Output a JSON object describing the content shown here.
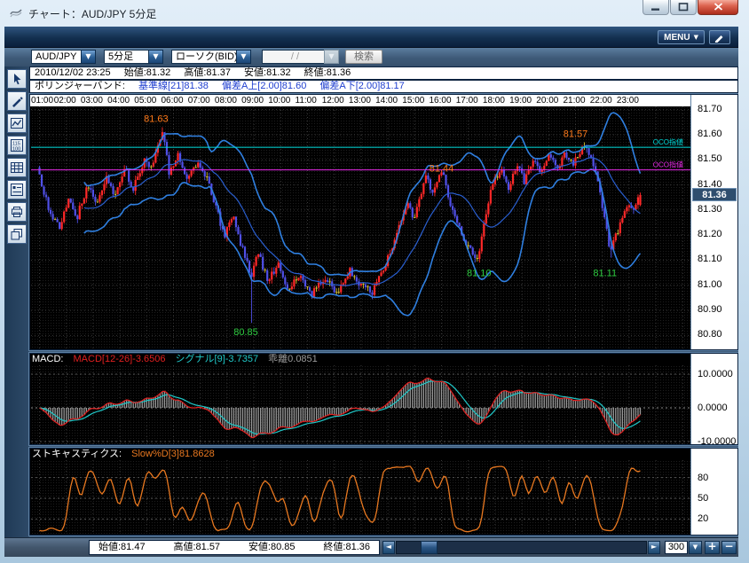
{
  "titlebar": {
    "title": "チャート：AUD/JPY 5分足"
  },
  "menubar": {
    "menu_label": "MENU"
  },
  "toolbar": {
    "pair": "AUD/JPY",
    "timeframe": "5分足",
    "style": "ローソク(BID)",
    "date_value": "/    /",
    "search_label": "検索"
  },
  "left_toolbar": {
    "icons": [
      "pointer",
      "pencil",
      "indicator",
      "quote-list",
      "grid",
      "settings",
      "printer",
      "new-window"
    ]
  },
  "quote_bar": {
    "datetime": "2010/12/02 23:25",
    "open": "始値:81.32",
    "high": "高値:81.37",
    "low": "安値:81.32",
    "close": "終値:81.36"
  },
  "bollinger_bar": {
    "label": "ボリンジャーバンド:",
    "center": "基準線[21]81.38",
    "upper": "偏差A上[2.00]81.60",
    "lower": "偏差A下[2.00]81.17"
  },
  "macd_bar": {
    "label": "MACD:",
    "macd": "MACD[12-26]-3.6506",
    "signal": "シグナル[9]-3.7357",
    "divergence": "乖離0.0851"
  },
  "stoch_bar": {
    "label": "ストキャスティクス:",
    "value": "Slow%D[3]81.8628"
  },
  "bottom_bar": {
    "open": "始値:81.47",
    "high": "高値:81.57",
    "low": "安値:80.85",
    "close": "終値:81.36",
    "bar_count": "300",
    "scroll_left": "◄",
    "scroll_right": "►",
    "count_caret": "▼",
    "zoom_in": "+",
    "zoom_out": "−"
  },
  "price_axis": {
    "ticks": [
      "81.70",
      "81.60",
      "81.50",
      "81.40",
      "81.30",
      "81.20",
      "81.10",
      "81.00",
      "80.90",
      "80.80"
    ],
    "current": "81.36"
  },
  "macd_axis": [
    "10.0000",
    "0.0000",
    "-10.0000"
  ],
  "stoch_axis": [
    "80",
    "50",
    "20"
  ],
  "time_axis": [
    "01:00",
    "02:00",
    "03:00",
    "04:00",
    "05:00",
    "06:00",
    "07:00",
    "08:00",
    "09:00",
    "10:00",
    "11:00",
    "12:00",
    "13:00",
    "14:00",
    "15:00",
    "16:00",
    "17:00",
    "18:00",
    "19:00",
    "20:00",
    "21:00",
    "22:00",
    "23:00"
  ],
  "chart_data": {
    "type": "candlestick+indicators",
    "pair": "AUD/JPY",
    "bar_interval_minutes": 5,
    "date": "2010/12/02",
    "visible_hours": [
      1.0,
      23.42
    ],
    "session_ohlc": {
      "open": 81.47,
      "high": 81.57,
      "low": 80.85,
      "close": 81.36
    },
    "main": {
      "ylim": [
        80.75,
        81.71
      ],
      "yticks": [
        80.8,
        80.9,
        81.0,
        81.1,
        81.2,
        81.3,
        81.4,
        81.5,
        81.6,
        81.7
      ],
      "last_price": 81.36,
      "bollinger": {
        "period": 21,
        "deviation": 2.0,
        "center": 81.38,
        "upper": 81.6,
        "lower": 81.17
      },
      "price_waypoints": [
        [
          1.0,
          81.44
        ],
        [
          1.35,
          81.3
        ],
        [
          1.75,
          81.23
        ],
        [
          2.1,
          81.35
        ],
        [
          2.4,
          81.27
        ],
        [
          2.8,
          81.4
        ],
        [
          3.1,
          81.32
        ],
        [
          3.5,
          81.44
        ],
        [
          3.8,
          81.36
        ],
        [
          4.2,
          81.46
        ],
        [
          4.5,
          81.38
        ],
        [
          4.9,
          81.5
        ],
        [
          5.15,
          81.46
        ],
        [
          5.6,
          81.61
        ],
        [
          5.85,
          81.44
        ],
        [
          6.2,
          81.52
        ],
        [
          6.5,
          81.41
        ],
        [
          6.9,
          81.5
        ],
        [
          7.2,
          81.44
        ],
        [
          7.6,
          81.3
        ],
        [
          7.9,
          81.2
        ],
        [
          8.2,
          81.28
        ],
        [
          8.55,
          81.15
        ],
        [
          8.9,
          81.04
        ],
        [
          9.15,
          81.14
        ],
        [
          9.5,
          81.02
        ],
        [
          9.9,
          81.08
        ],
        [
          10.3,
          80.98
        ],
        [
          10.7,
          81.05
        ],
        [
          11.1,
          80.96
        ],
        [
          11.6,
          81.03
        ],
        [
          12.1,
          80.97
        ],
        [
          12.6,
          81.06
        ],
        [
          13.0,
          81.0
        ],
        [
          13.4,
          80.97
        ],
        [
          13.9,
          81.08
        ],
        [
          14.3,
          81.2
        ],
        [
          14.7,
          81.33
        ],
        [
          15.0,
          81.26
        ],
        [
          15.4,
          81.44
        ],
        [
          15.7,
          81.36
        ],
        [
          16.0,
          81.46
        ],
        [
          16.4,
          81.3
        ],
        [
          16.9,
          81.16
        ],
        [
          17.35,
          81.11
        ],
        [
          17.6,
          81.26
        ],
        [
          17.9,
          81.4
        ],
        [
          18.2,
          81.47
        ],
        [
          18.5,
          81.38
        ],
        [
          18.8,
          81.48
        ],
        [
          19.1,
          81.41
        ],
        [
          19.4,
          81.5
        ],
        [
          19.7,
          81.44
        ],
        [
          20.0,
          81.52
        ],
        [
          20.3,
          81.46
        ],
        [
          20.6,
          81.53
        ],
        [
          20.9,
          81.48
        ],
        [
          21.3,
          81.56
        ],
        [
          21.6,
          81.5
        ],
        [
          21.85,
          81.4
        ],
        [
          22.05,
          81.28
        ],
        [
          22.3,
          81.14
        ],
        [
          22.45,
          81.18
        ],
        [
          22.7,
          81.26
        ],
        [
          22.9,
          81.32
        ],
        [
          23.1,
          81.29
        ],
        [
          23.42,
          81.36
        ]
      ],
      "extremes": [
        {
          "hour": 5.6,
          "price": 81.63,
          "kind": "high"
        },
        {
          "hour": 21.3,
          "price": 81.57,
          "kind": "high"
        },
        {
          "hour": 8.9,
          "price": 80.85,
          "kind": "spike-low"
        },
        {
          "hour": 17.35,
          "price": 81.1,
          "kind": "low"
        },
        {
          "hour": 22.3,
          "price": 81.11,
          "kind": "low"
        }
      ],
      "order_lines": [
        {
          "price": 81.55,
          "label": "OCO指値",
          "color": "#00dede"
        },
        {
          "price": 81.46,
          "label": "OCO指値",
          "color": "#e82ae8"
        }
      ],
      "annotations": [
        {
          "text": "81.63",
          "hour": 5.35,
          "price": 81.665,
          "color": "#ff7a1a"
        },
        {
          "text": "81.57",
          "hour": 21.0,
          "price": 81.605,
          "color": "#ff7a1a"
        },
        {
          "text": "81.44",
          "hour": 16.0,
          "price": 81.468,
          "color": "#ff7a1a"
        },
        {
          "text": "81.10",
          "hour": 17.4,
          "price": 81.05,
          "color": "#2ecc40"
        },
        {
          "text": "81.11",
          "hour": 22.1,
          "price": 81.05,
          "color": "#2ecc40"
        },
        {
          "text": "80.85",
          "hour": 8.7,
          "price": 80.815,
          "color": "#2ecc40"
        }
      ]
    },
    "macd": {
      "fast": 12,
      "slow": 26,
      "signal_period": 9,
      "value": -3.6506,
      "signal": -3.7357,
      "divergence": 0.0851,
      "yticks": [
        10,
        0,
        -10
      ]
    },
    "stochastics": {
      "slowd_period": 3,
      "value": 81.8628,
      "yticks": [
        80,
        50,
        20
      ]
    },
    "colors": {
      "up_candle": "#ff2828",
      "down_candle": "#5050e8",
      "doji": "#d8c030",
      "bollinger_outer": "#2f7fe0",
      "bollinger_center": "#2a5fd0",
      "macd_line": "#e02020",
      "signal_line": "#20c8c8",
      "histogram": "#9a9a9a",
      "stoch_line": "#e87820",
      "annotation_orange": "#ff7a1a",
      "annotation_green": "#2ecc40",
      "current_price_bg": "#2f4e6e"
    }
  }
}
